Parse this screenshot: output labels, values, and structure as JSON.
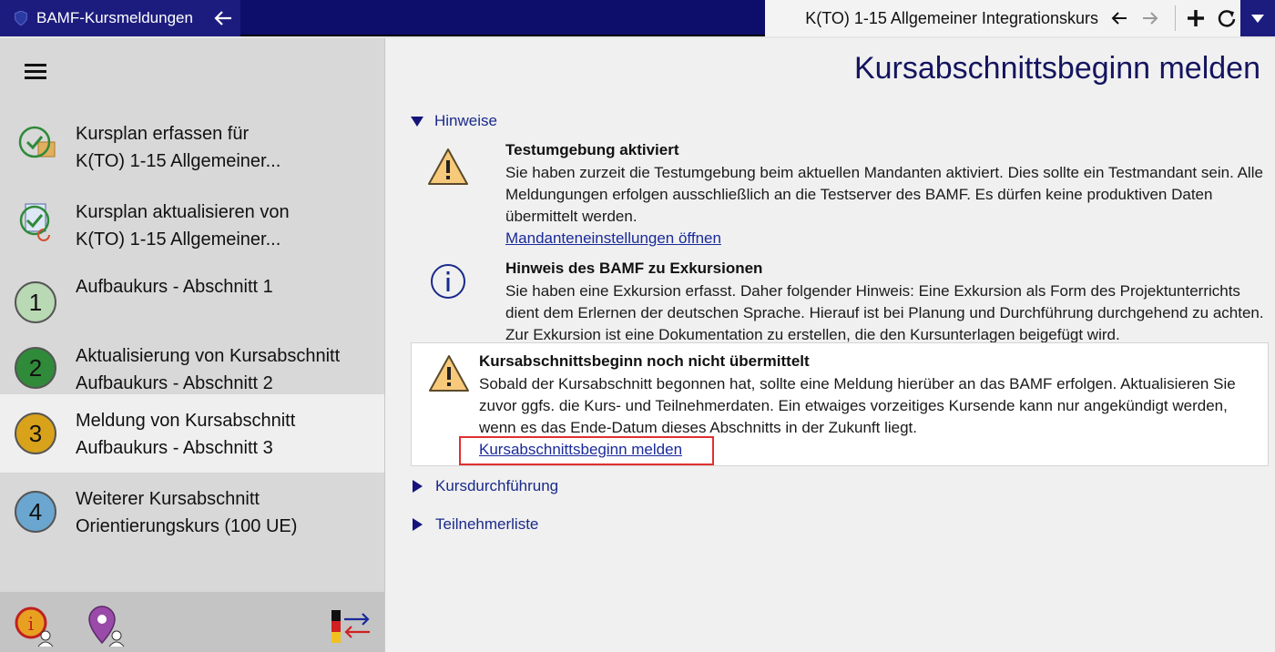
{
  "app": {
    "name": "BAMF-Kursmeldungen"
  },
  "header": {
    "course": "K(TO) 1-15 Allgemeiner Integrationskurs"
  },
  "sidebar": {
    "items": [
      {
        "line1": "Kursplan erfassen für",
        "line2": "K(TO) 1-15 Allgemeiner..."
      },
      {
        "line1": "Kursplan aktualisieren von",
        "line2": "K(TO) 1-15 Allgemeiner..."
      },
      {
        "number": "1",
        "line1": "Aufbaukurs - Abschnitt 1",
        "color": "#b9d8b4"
      },
      {
        "number": "2",
        "line1": "Aktualisierung von Kursabschnitt",
        "line2": "Aufbaukurs - Abschnitt 2",
        "color": "#2f8a3a"
      },
      {
        "number": "3",
        "line1": "Meldung von Kursabschnitt",
        "line2": "Aufbaukurs - Abschnitt 3",
        "color": "#d9a21b"
      },
      {
        "number": "4",
        "line1": "Weiterer Kursabschnitt",
        "line2": "Orientierungskurs (100 UE)",
        "color": "#6aa6cf"
      }
    ]
  },
  "main": {
    "title": "Kursabschnittsbeginn melden",
    "hinweise_label": "Hinweise",
    "notes": [
      {
        "icon": "warning-icon",
        "title": "Testumgebung aktiviert",
        "body": "Sie haben zurzeit die Testumgebung beim aktuellen Mandanten aktiviert. Dies sollte ein Testmandant sein. Alle Meldungungen erfolgen ausschließlich an die Testserver des BAMF. Es dürfen keine produktiven Daten übermittelt werden.",
        "link": "Mandanteneinstellungen öffnen"
      },
      {
        "icon": "info-icon",
        "title": "Hinweis des BAMF zu Exkursionen",
        "body": "Sie haben eine Exkursion erfasst. Daher folgender Hinweis: Eine Exkursion als Form des Projektunterrichts dient dem Erlernen der deutschen Sprache. Hierauf ist bei Planung und Durchführung durchgehend zu achten. Zur Exkursion ist eine Dokumentation zu erstellen, die den Kursunterlagen beigefügt wird."
      },
      {
        "icon": "warning-icon",
        "title": "Kursabschnittsbeginn noch nicht übermittelt",
        "body": "Sobald der Kursabschnitt begonnen hat, sollte eine Meldung hierüber an das BAMF erfolgen. Aktualisieren Sie zuvor ggfs. die Kurs- und Teilnehmerdaten. Ein etwaiges vorzeitiges Kursende kann nur angekündigt werden, wenn es das Ende-Datum dieses Abschnitts in der Zukunft liegt.",
        "link": "Kursabschnittsbeginn melden"
      }
    ],
    "sections": [
      "Kursdurchführung",
      "Teilnehmerliste"
    ]
  },
  "colors": {
    "accent": "#1c1c7e",
    "highlight": "#e03030",
    "warning": "#f7c97a"
  }
}
